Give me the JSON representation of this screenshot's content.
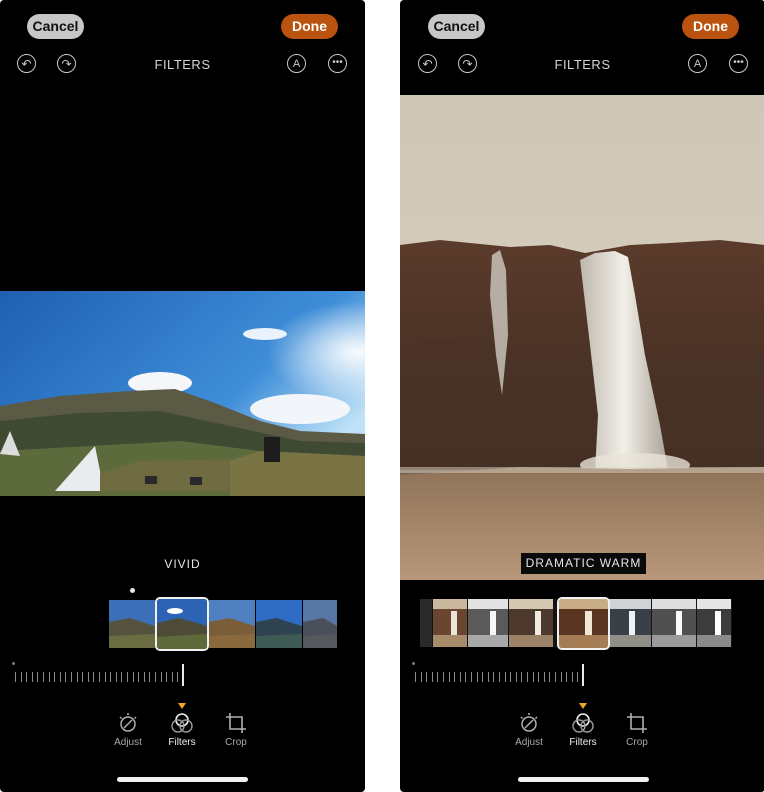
{
  "left_screen": {
    "cancel_label": "Cancel",
    "done_label": "Done",
    "title": "FILTERS",
    "filter_name": "VIVID",
    "tools": [
      {
        "label": "Adjust",
        "icon": "adjust-icon"
      },
      {
        "label": "Filters",
        "icon": "filters-icon"
      },
      {
        "label": "Crop",
        "icon": "crop-icon"
      }
    ],
    "active_tool": "Filters",
    "photo_subject": "landscape with sky, mountain and turf-roofed houses"
  },
  "right_screen": {
    "cancel_label": "Cancel",
    "done_label": "Done",
    "title": "FILTERS",
    "filter_name": "DRAMATIC WARM",
    "tools": [
      {
        "label": "Adjust",
        "icon": "adjust-icon"
      },
      {
        "label": "Filters",
        "icon": "filters-icon"
      },
      {
        "label": "Crop",
        "icon": "crop-icon"
      }
    ],
    "active_tool": "Filters",
    "photo_subject": "waterfall over a cliff"
  },
  "icons": {
    "undo": "undo-icon",
    "redo": "redo-icon",
    "markup": "markup-icon",
    "more": "more-icon"
  },
  "colors": {
    "done_button": "#b9530f",
    "cancel_button": "#c7c7c9",
    "filter_marker": "#f0a81c",
    "background": "#000000"
  }
}
